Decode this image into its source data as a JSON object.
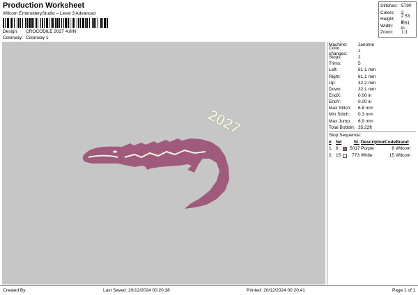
{
  "header": {
    "title": "Production Worksheet",
    "subtitle": "Wilcom EmbroideryStudio – Level 3 Advanced",
    "design_label": "Design:",
    "design_value": "CROCODILE 2027 4.8IN",
    "colorway_label": "Colorway:",
    "colorway_value": "Colorway 1"
  },
  "stats": [
    {
      "label": "Stitches:",
      "value": "5790"
    },
    {
      "label": "Colors:",
      "value": "2"
    },
    {
      "label": "Height:",
      "value": "2.53 in"
    },
    {
      "label": "Width:",
      "value": "4.81 in"
    },
    {
      "label": "Zoom:",
      "value": "1:1"
    }
  ],
  "machine_info": [
    {
      "label": "Machine:",
      "value": "Janome"
    },
    {
      "label": "Color changes:",
      "value": "1"
    },
    {
      "label": "Stops:",
      "value": "2"
    },
    {
      "label": "Trims:",
      "value": "5"
    },
    {
      "label": "Left:",
      "value": "61.1 mm"
    },
    {
      "label": "Right:",
      "value": "61.1 mm"
    },
    {
      "label": "Up:",
      "value": "32.2 mm"
    },
    {
      "label": "Down:",
      "value": "32.1 mm"
    },
    {
      "label": "EndX:",
      "value": "0.00 in"
    },
    {
      "label": "EndY:",
      "value": "0.00 in"
    },
    {
      "label": "Max Stitch:",
      "value": "6.8 mm"
    },
    {
      "label": "Min Stitch:",
      "value": "0.3 mm"
    },
    {
      "label": "Max Jump:",
      "value": "6.9 mm"
    },
    {
      "label": "Total Bobbin:",
      "value": "35.22ft"
    }
  ],
  "stop_sequence": {
    "title": "Stop Sequence:",
    "headers": {
      "num": "#",
      "n": "N#",
      "st": "St.",
      "desc": "Description",
      "code": "Code",
      "brand": "Brand"
    },
    "rows": [
      {
        "num": "1.",
        "n": "8",
        "color": "#a05a7c",
        "st": "5017",
        "desc": "Purple",
        "code": "8",
        "brand": "Wilcom"
      },
      {
        "num": "2.",
        "n": "15",
        "color": "#ffffff",
        "st": "773",
        "desc": "White",
        "code": "15",
        "brand": "Wilcom"
      }
    ]
  },
  "design_text": "2027",
  "colors": {
    "canvas": "#c6c6c6",
    "thread_purple": "#a05a7c",
    "thread_white": "#f4f6e8"
  },
  "footer": {
    "created": "Created By:",
    "saved": "Last Saved: 20/12/2024 00.20.38",
    "printed": "Printed: 20/12/2024 00.20.41",
    "page": "Page 1 of 1"
  }
}
